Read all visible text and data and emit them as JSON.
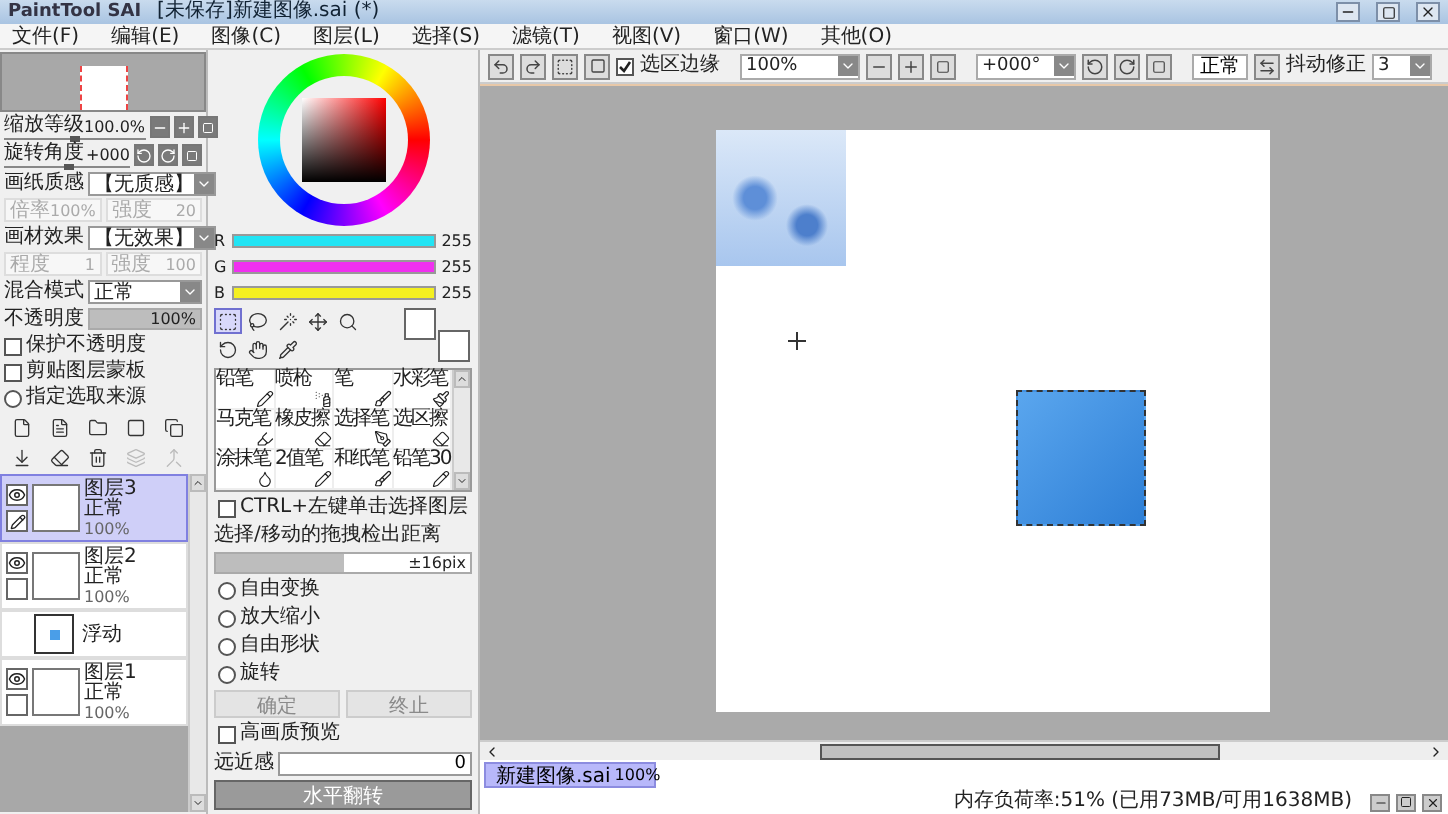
{
  "title_bar": {
    "app": "PaintTool SAI",
    "document": "[未保存]新建图像.sai (*)"
  },
  "menu": [
    "文件(F)",
    "编辑(E)",
    "图像(C)",
    "图层(L)",
    "选择(S)",
    "滤镜(T)",
    "视图(V)",
    "窗口(W)",
    "其他(O)"
  ],
  "view_controls": [
    {
      "label": "缩放等级",
      "value": "100.0%",
      "level": 0.5
    },
    {
      "label": "旋转角度",
      "value": "+000",
      "level": 0.5
    }
  ],
  "paper_texture": {
    "label": "画纸质感",
    "value": "【无质感】",
    "fields": [
      {
        "label": "倍率",
        "value": "100%",
        "disabled": true
      },
      {
        "label": "强度",
        "value": "20",
        "disabled": true
      }
    ]
  },
  "brush_texture": {
    "label": "画材效果",
    "value": "【无效果】",
    "fields": [
      {
        "label": "程度",
        "value": "1",
        "disabled": true
      },
      {
        "label": "强度",
        "value": "100",
        "disabled": true
      }
    ]
  },
  "blend_mode": {
    "label": "混合模式",
    "value": "正常"
  },
  "opacity": {
    "label": "不透明度",
    "value": "100%",
    "level": 1
  },
  "layer_options": [
    {
      "label": "保护不透明度",
      "checked": false
    },
    {
      "label": "剪贴图层蒙板",
      "checked": false
    },
    {
      "label": "指定选取来源",
      "checked": false
    }
  ],
  "layer_buttons": [
    {
      "kind": "new-layer",
      "disabled": false
    },
    {
      "kind": "new-linework",
      "disabled": false
    },
    {
      "kind": "new-folder",
      "disabled": false
    },
    {
      "kind": "mask",
      "disabled": false
    },
    {
      "kind": "copy",
      "disabled": false
    },
    {
      "kind": "merge-down",
      "disabled": false
    },
    {
      "kind": "clear",
      "disabled": false
    },
    {
      "kind": "delete",
      "disabled": false
    },
    {
      "kind": "merge",
      "disabled": true
    },
    {
      "kind": "flatten",
      "disabled": true
    }
  ],
  "layers": [
    {
      "kind": "layer",
      "name": "图层3",
      "mode": "正常",
      "opacity": "100%",
      "visible": true,
      "selected": true
    },
    {
      "kind": "layer",
      "name": "图层2",
      "mode": "正常",
      "opacity": "100%",
      "visible": true,
      "selected": false
    },
    {
      "kind": "floating",
      "name": "浮动",
      "selected": false
    },
    {
      "kind": "layer",
      "name": "图层1",
      "mode": "正常",
      "opacity": "100%",
      "visible": true,
      "selected": false
    }
  ],
  "color_channels": [
    {
      "name": "R",
      "value": "255",
      "level": 1,
      "color": "#22e4f4"
    },
    {
      "name": "G",
      "value": "255",
      "level": 1,
      "color": "#f030f0"
    },
    {
      "name": "B",
      "value": "255",
      "level": 1,
      "color": "#f4f020"
    }
  ],
  "tools": [
    {
      "kind": "marquee",
      "selected": true
    },
    {
      "kind": "lasso",
      "selected": false
    },
    {
      "kind": "wand",
      "selected": false
    },
    {
      "kind": "move",
      "selected": false
    },
    {
      "kind": "zoom",
      "selected": false
    },
    {
      "kind": "rotate",
      "selected": false
    },
    {
      "kind": "hand",
      "selected": false
    },
    {
      "kind": "eyedropper",
      "selected": false
    }
  ],
  "brushes": [
    {
      "label": "铅笔",
      "kind": "pencil"
    },
    {
      "label": "喷枪",
      "kind": "airbrush"
    },
    {
      "label": "笔",
      "kind": "brush"
    },
    {
      "label": "水彩笔",
      "kind": "watercolor"
    },
    {
      "label": "马克笔",
      "kind": "marker"
    },
    {
      "label": "橡皮擦",
      "kind": "eraser"
    },
    {
      "label": "选择笔",
      "kind": "select-pen"
    },
    {
      "label": "选区擦",
      "kind": "select-eraser"
    },
    {
      "label": "涂抹笔",
      "kind": "blur"
    },
    {
      "label": "2值笔",
      "kind": "pencil"
    },
    {
      "label": "和纸笔",
      "kind": "brush"
    },
    {
      "label": "铅笔30",
      "kind": "pencil"
    }
  ],
  "ctrl_option": {
    "label": "CTRL+左键单击选择图层",
    "checked": false
  },
  "drag_distance": {
    "label": "选择/移动的拖拽检出距离",
    "value": "±16pix",
    "level": 0.5
  },
  "transform_modes": [
    {
      "label": "自由变换",
      "selected": false
    },
    {
      "label": "放大缩小",
      "selected": false
    },
    {
      "label": "自由形状",
      "selected": false
    },
    {
      "label": "旋转",
      "selected": false
    }
  ],
  "transform_buttons": [
    {
      "label": "确定",
      "disabled": true
    },
    {
      "label": "终止",
      "disabled": true
    }
  ],
  "hq_preview": {
    "label": "高画质预览",
    "checked": false
  },
  "perspective": {
    "label": "远近感",
    "value": "0"
  },
  "flip_button": "水平翻转",
  "toolbar": {
    "selection_edge": {
      "label": "选区边缘",
      "checked": true
    },
    "zoom": "100%",
    "angle": "+000°",
    "mode": "正常",
    "stabilizer": {
      "label": "抖动修正",
      "value": "3"
    }
  },
  "tabs": [
    {
      "label": "新建图像.sai",
      "zoom": "100%",
      "selected": true
    }
  ],
  "status": "内存负荷率:51% (已用73MB/可用1638MB)"
}
